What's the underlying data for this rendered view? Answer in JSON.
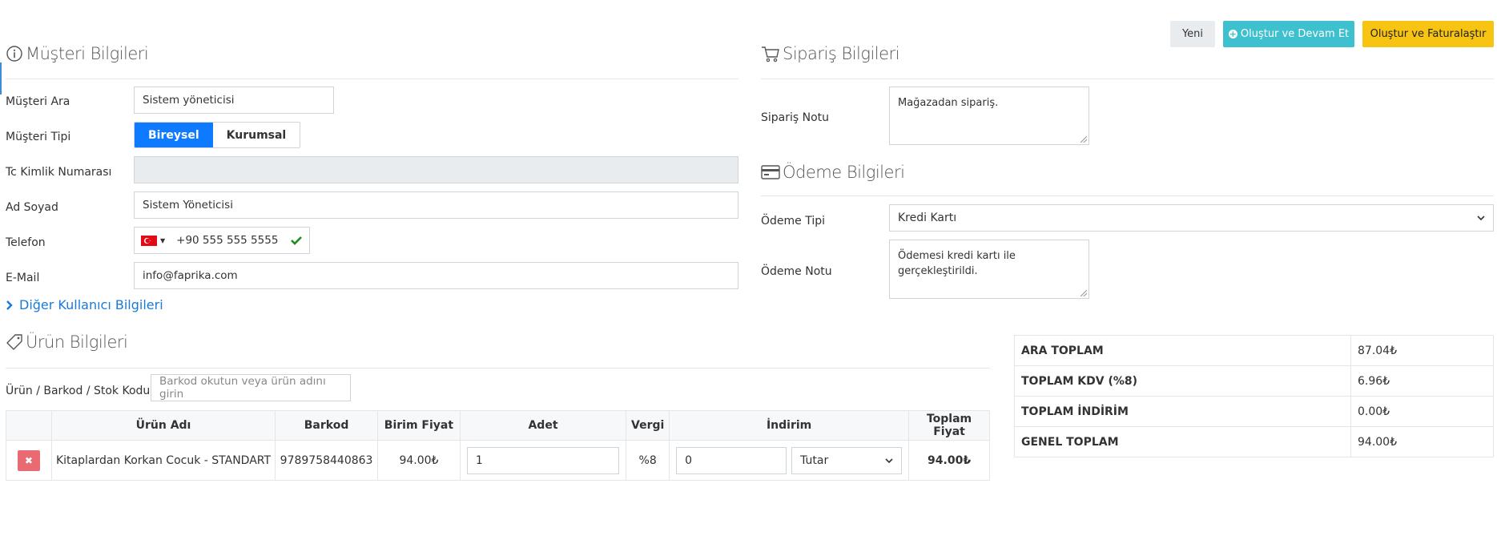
{
  "toolbar": {
    "new_label": "Yeni",
    "create_continue_label": "Oluştur ve Devam Et",
    "create_invoice_label": "Oluştur ve Faturalaştır"
  },
  "customer": {
    "title": "Müşteri Bilgileri",
    "search_label": "Müşteri Ara",
    "search_value": "Sistem yöneticisi",
    "type_label": "Müşteri Tipi",
    "type_options": [
      "Bireysel",
      "Kurumsal"
    ],
    "type_selected": "Bireysel",
    "tc_label": "Tc Kimlik Numarası",
    "tc_value": "",
    "name_label": "Ad Soyad",
    "name_value": "Sistem Yöneticisi",
    "phone_label": "Telefon",
    "phone_value": "+90 555 555 5555",
    "email_label": "E-Mail",
    "email_value": "info@faprika.com",
    "other_link": "Diğer Kullanıcı Bilgileri"
  },
  "order": {
    "title": "Sipariş Bilgileri",
    "note_label": "Sipariş Notu",
    "note_value": "Mağazadan sipariş."
  },
  "payment": {
    "title": "Ödeme Bilgileri",
    "type_label": "Ödeme Tipi",
    "type_value": "Kredi Kartı",
    "note_label": "Ödeme Notu",
    "note_value": "Ödemesi kredi kartı ile gerçekleştirildi."
  },
  "products": {
    "title": "Ürün Bilgileri",
    "search_label": "Ürün / Barkod / Stok Kodu",
    "search_placeholder": "Barkod okutun veya ürün adını girin",
    "columns": [
      "",
      "Ürün Adı",
      "Barkod",
      "Birim Fiyat",
      "Adet",
      "Vergi",
      "İndirim",
      "Toplam Fiyat"
    ],
    "rows": [
      {
        "name": "Kitaplardan Korkan Cocuk - STANDART",
        "barcode": "9789758440863",
        "unit_price": "94.00₺",
        "qty": "1",
        "tax": "%8",
        "discount": "0",
        "discount_type": "Tutar",
        "total": "94.00₺"
      }
    ]
  },
  "totals": {
    "subtotal_label": "ARA TOPLAM",
    "subtotal_value": "87.04₺",
    "vat_label": "TOPLAM KDV (%8)",
    "vat_value": "6.96₺",
    "discount_label": "TOPLAM İNDİRİM",
    "discount_value": "0.00₺",
    "grand_label": "GENEL TOPLAM",
    "grand_value": "94.00₺"
  },
  "colors": {
    "primary": "#0d7aff",
    "info": "#3fc0cf",
    "warning": "#f8c413",
    "danger": "#ea6a73",
    "success": "#1a8f1a"
  }
}
